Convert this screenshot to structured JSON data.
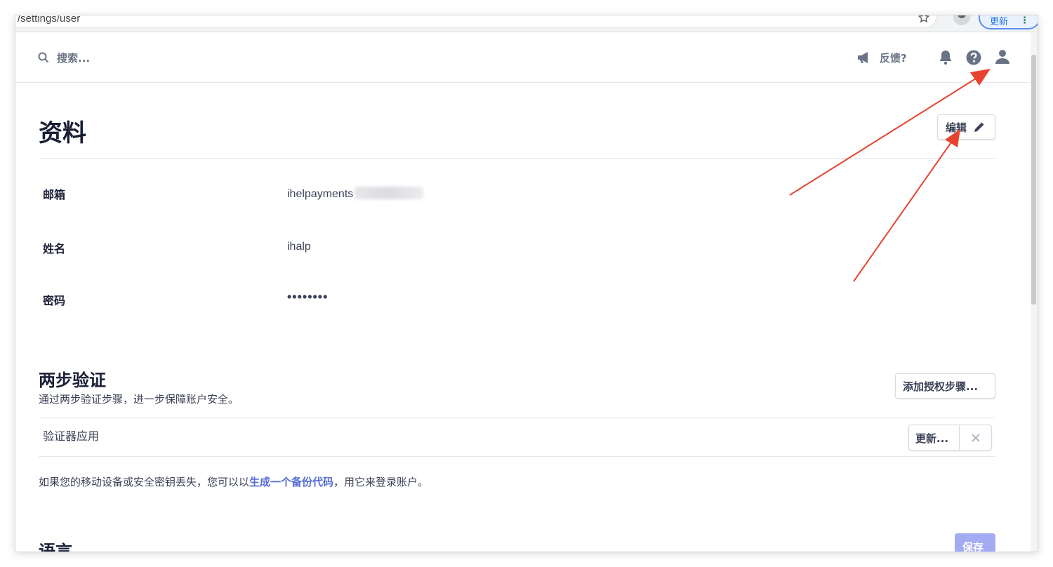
{
  "browser": {
    "url": "/settings/user",
    "update_label": "更新",
    "menu_glyph": "⋮"
  },
  "header": {
    "search_label": "搜索...",
    "feedback_label": "反馈?"
  },
  "profile": {
    "title": "资料",
    "edit_label": "编辑",
    "fields": [
      {
        "label": "邮箱",
        "value": "ihelpayments"
      },
      {
        "label": "姓名",
        "value": "ihalp"
      },
      {
        "label": "密码",
        "value": "••••••••"
      }
    ]
  },
  "two_step": {
    "title": "两步验证",
    "description": "通过两步验证步骤，进一步保障账户安全。",
    "add_step_label": "添加授权步骤...",
    "authenticator_label": "验证器应用",
    "update_label": "更新...",
    "backup_prefix": "如果您的移动设备或安全密钥丢失，您可以以",
    "backup_link": "生成一个备份代码",
    "backup_suffix": "，用它来登录账户。"
  },
  "language": {
    "title": "语言",
    "save_label": "保存"
  },
  "colors": {
    "annotation_arrow": "#e8432e",
    "link": "#556cd6",
    "save_button": "#a3acf2"
  }
}
